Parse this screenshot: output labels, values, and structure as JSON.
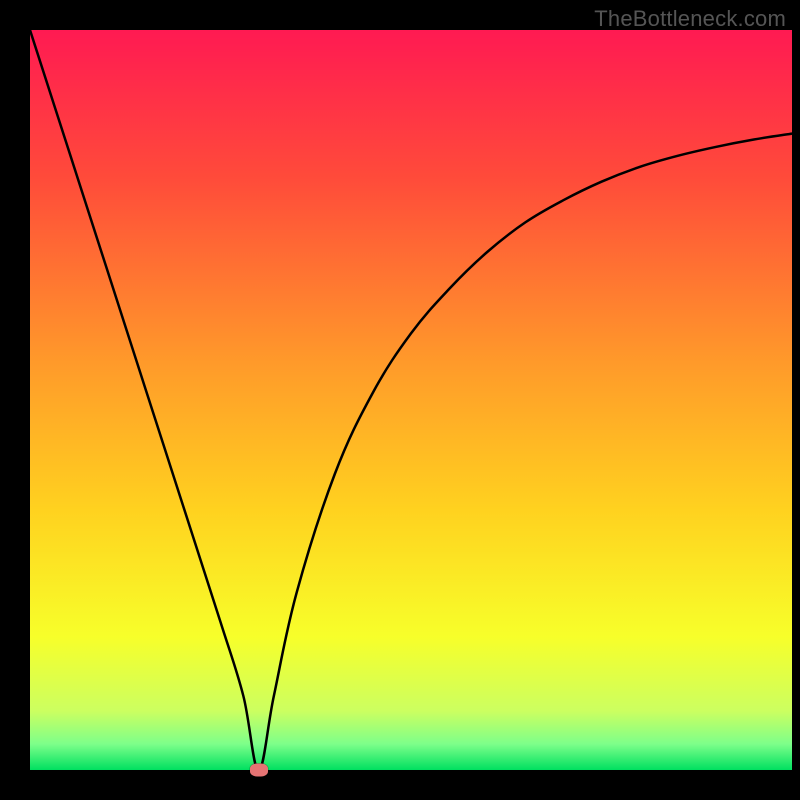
{
  "watermark": "TheBottleneck.com",
  "chart_data": {
    "type": "line",
    "title": "",
    "xlabel": "",
    "ylabel": "",
    "xlim": [
      0,
      100
    ],
    "ylim": [
      0,
      100
    ],
    "grid": false,
    "legend": false,
    "series": [
      {
        "name": "bottleneck-curve",
        "x": [
          0,
          5,
          10,
          15,
          20,
          25,
          28,
          30,
          32,
          35,
          40,
          45,
          50,
          55,
          60,
          65,
          70,
          75,
          80,
          85,
          90,
          95,
          100
        ],
        "y": [
          100,
          84,
          68,
          52,
          36,
          20,
          10,
          0,
          10,
          24,
          40,
          51,
          59,
          65,
          70,
          74,
          77,
          79.5,
          81.5,
          83,
          84.2,
          85.2,
          86
        ]
      }
    ],
    "annotations": [
      {
        "name": "optimal-point",
        "x": 30,
        "y": 0
      }
    ],
    "gradient_stops": [
      {
        "pos": 0.0,
        "color": "#ff1a52"
      },
      {
        "pos": 0.2,
        "color": "#ff4b3a"
      },
      {
        "pos": 0.45,
        "color": "#ff9a2a"
      },
      {
        "pos": 0.65,
        "color": "#ffd21f"
      },
      {
        "pos": 0.82,
        "color": "#f7ff2a"
      },
      {
        "pos": 0.92,
        "color": "#ccff60"
      },
      {
        "pos": 0.965,
        "color": "#7dff8a"
      },
      {
        "pos": 1.0,
        "color": "#00e060"
      }
    ]
  }
}
